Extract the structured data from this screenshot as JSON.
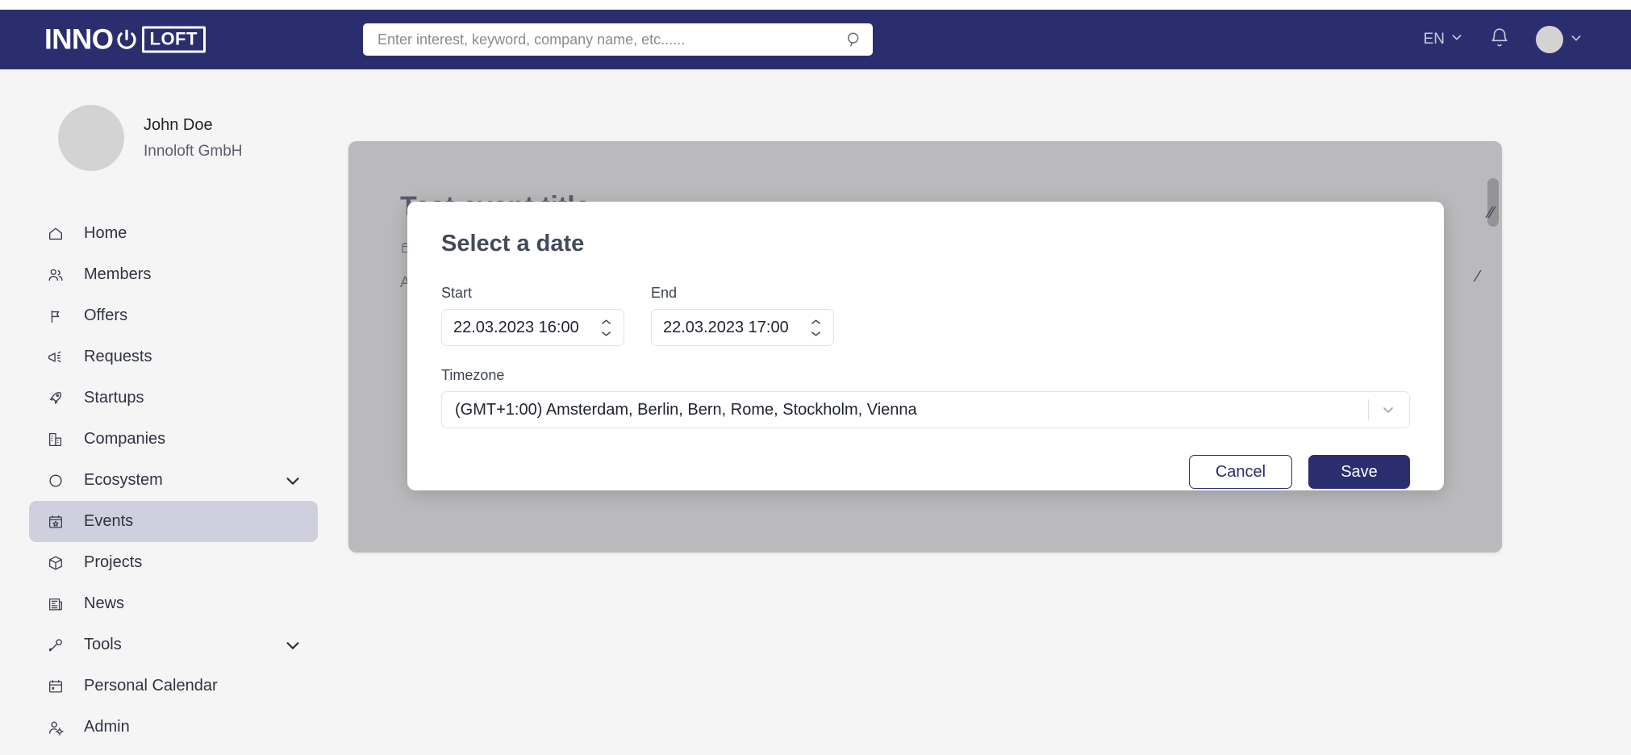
{
  "colors": {
    "brand_navy": "#2b2e6e",
    "page_bg": "#f5f5f6",
    "active_nav_bg": "#cfcfdd",
    "overlay_grey": "#828285"
  },
  "header": {
    "logo_primary": "INNO",
    "logo_secondary": "LOFT",
    "logo_icon": "power-icon",
    "search": {
      "placeholder": "Enter interest, keyword, company name, etc......",
      "value": "",
      "icon": "search-icon"
    },
    "language": "EN",
    "language_chevron": "chevron-down-icon",
    "notifications_icon": "bell-icon",
    "avatar_chevron": "chevron-down-icon"
  },
  "sidebar": {
    "profile": {
      "name": "John Doe",
      "organization": "Innoloft GmbH"
    },
    "items": [
      {
        "label": "Home",
        "icon": "home-icon",
        "active": false,
        "expandable": false
      },
      {
        "label": "Members",
        "icon": "members-icon",
        "active": false,
        "expandable": false
      },
      {
        "label": "Offers",
        "icon": "offers-icon",
        "active": false,
        "expandable": false
      },
      {
        "label": "Requests",
        "icon": "megaphone-icon",
        "active": false,
        "expandable": false
      },
      {
        "label": "Startups",
        "icon": "rocket-icon",
        "active": false,
        "expandable": false
      },
      {
        "label": "Companies",
        "icon": "building-icon",
        "active": false,
        "expandable": false
      },
      {
        "label": "Ecosystem",
        "icon": "circle-icon",
        "active": false,
        "expandable": true
      },
      {
        "label": "Events",
        "icon": "calendar-star-icon",
        "active": true,
        "expandable": false
      },
      {
        "label": "Projects",
        "icon": "cube-icon",
        "active": false,
        "expandable": false
      },
      {
        "label": "News",
        "icon": "news-icon",
        "active": false,
        "expandable": false
      },
      {
        "label": "Tools",
        "icon": "wrench-icon",
        "active": false,
        "expandable": true
      },
      {
        "label": "Personal Calendar",
        "icon": "calendar-icon",
        "active": false,
        "expandable": false
      },
      {
        "label": "Admin",
        "icon": "user-gear-icon",
        "active": false,
        "expandable": false
      }
    ]
  },
  "main": {
    "event_title": "Test event title",
    "event_meta_icon": "calendar-icon",
    "event_meta": "",
    "event_description": "A"
  },
  "modal": {
    "title": "Select a date",
    "start": {
      "label": "Start",
      "value": "22.03.2023 16:00",
      "stepper_icon": "stepper-updown-icon"
    },
    "end": {
      "label": "End",
      "value": "22.03.2023 17:00",
      "stepper_icon": "stepper-updown-icon"
    },
    "timezone": {
      "label": "Timezone",
      "value": "(GMT+1:00) Amsterdam, Berlin, Bern, Rome, Stockholm, Vienna",
      "chevron_icon": "chevron-down-icon"
    },
    "cancel_label": "Cancel",
    "save_label": "Save"
  }
}
